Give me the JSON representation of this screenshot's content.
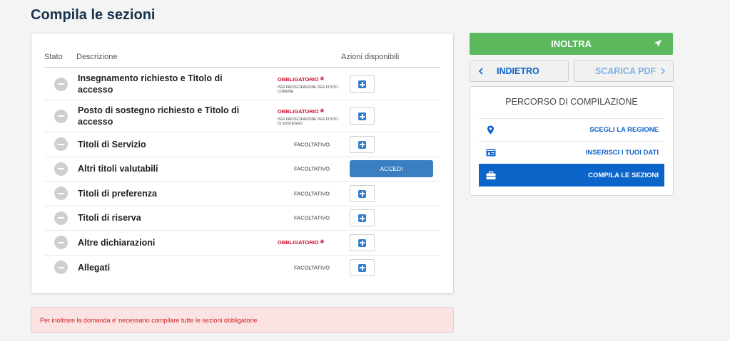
{
  "page": {
    "title": "Compila le sezioni"
  },
  "table": {
    "headers": {
      "stato": "Stato",
      "descrizione": "Descrizione",
      "azioni": "Azioni disponibili"
    },
    "rows": [
      {
        "descrizione": "Insegnamento richiesto e Titolo di accesso",
        "requirement": "OBBLIGATORIO",
        "required": true,
        "note": "PER PARTECIPAZIONE PER POSTO COMUNE",
        "action": "plus"
      },
      {
        "descrizione": "Posto di sostegno richiesto e Titolo di accesso",
        "requirement": "OBBLIGATORIO",
        "required": true,
        "note": "PER PARTECIPAZIONE PER POSTO DI SOSTEGNO",
        "action": "plus"
      },
      {
        "descrizione": "Titoli di Servizio",
        "requirement": "FACOLTATIVO",
        "required": false,
        "action": "plus"
      },
      {
        "descrizione": "Altri titoli valutabili",
        "requirement": "FACOLTATIVO",
        "required": false,
        "action": "accedi",
        "action_label": "ACCEDI"
      },
      {
        "descrizione": "Titoli di preferenza",
        "requirement": "FACOLTATIVO",
        "required": false,
        "action": "plus"
      },
      {
        "descrizione": "Titoli di riserva",
        "requirement": "FACOLTATIVO",
        "required": false,
        "action": "plus"
      },
      {
        "descrizione": "Altre dichiarazioni",
        "requirement": "OBBLIGATORIO",
        "required": true,
        "action": "plus"
      },
      {
        "descrizione": "Allegati",
        "requirement": "FACOLTATIVO",
        "required": false,
        "action": "plus"
      }
    ],
    "required_mark": "*"
  },
  "alert": {
    "text": "Per inoltrare la domanda e' necessario compilare tutte le sezioni obbligatorie"
  },
  "sidebar": {
    "inoltra_label": "INOLTRA",
    "indietro_label": "INDIETRO",
    "scarica_label": "SCARICA PDF",
    "percorso_title": "PERCORSO DI COMPILAZIONE",
    "steps": [
      {
        "label": "SCEGLI LA REGIONE",
        "icon": "map-pin-icon",
        "active": false
      },
      {
        "label": "INSERISCI I TUOI DATI",
        "icon": "id-card-icon",
        "active": false
      },
      {
        "label": "COMPILA LE SEZIONI",
        "icon": "briefcase-icon",
        "active": true
      }
    ]
  },
  "colors": {
    "accent": "#0b64c7",
    "success": "#5cb85c",
    "danger": "#c8102e"
  }
}
